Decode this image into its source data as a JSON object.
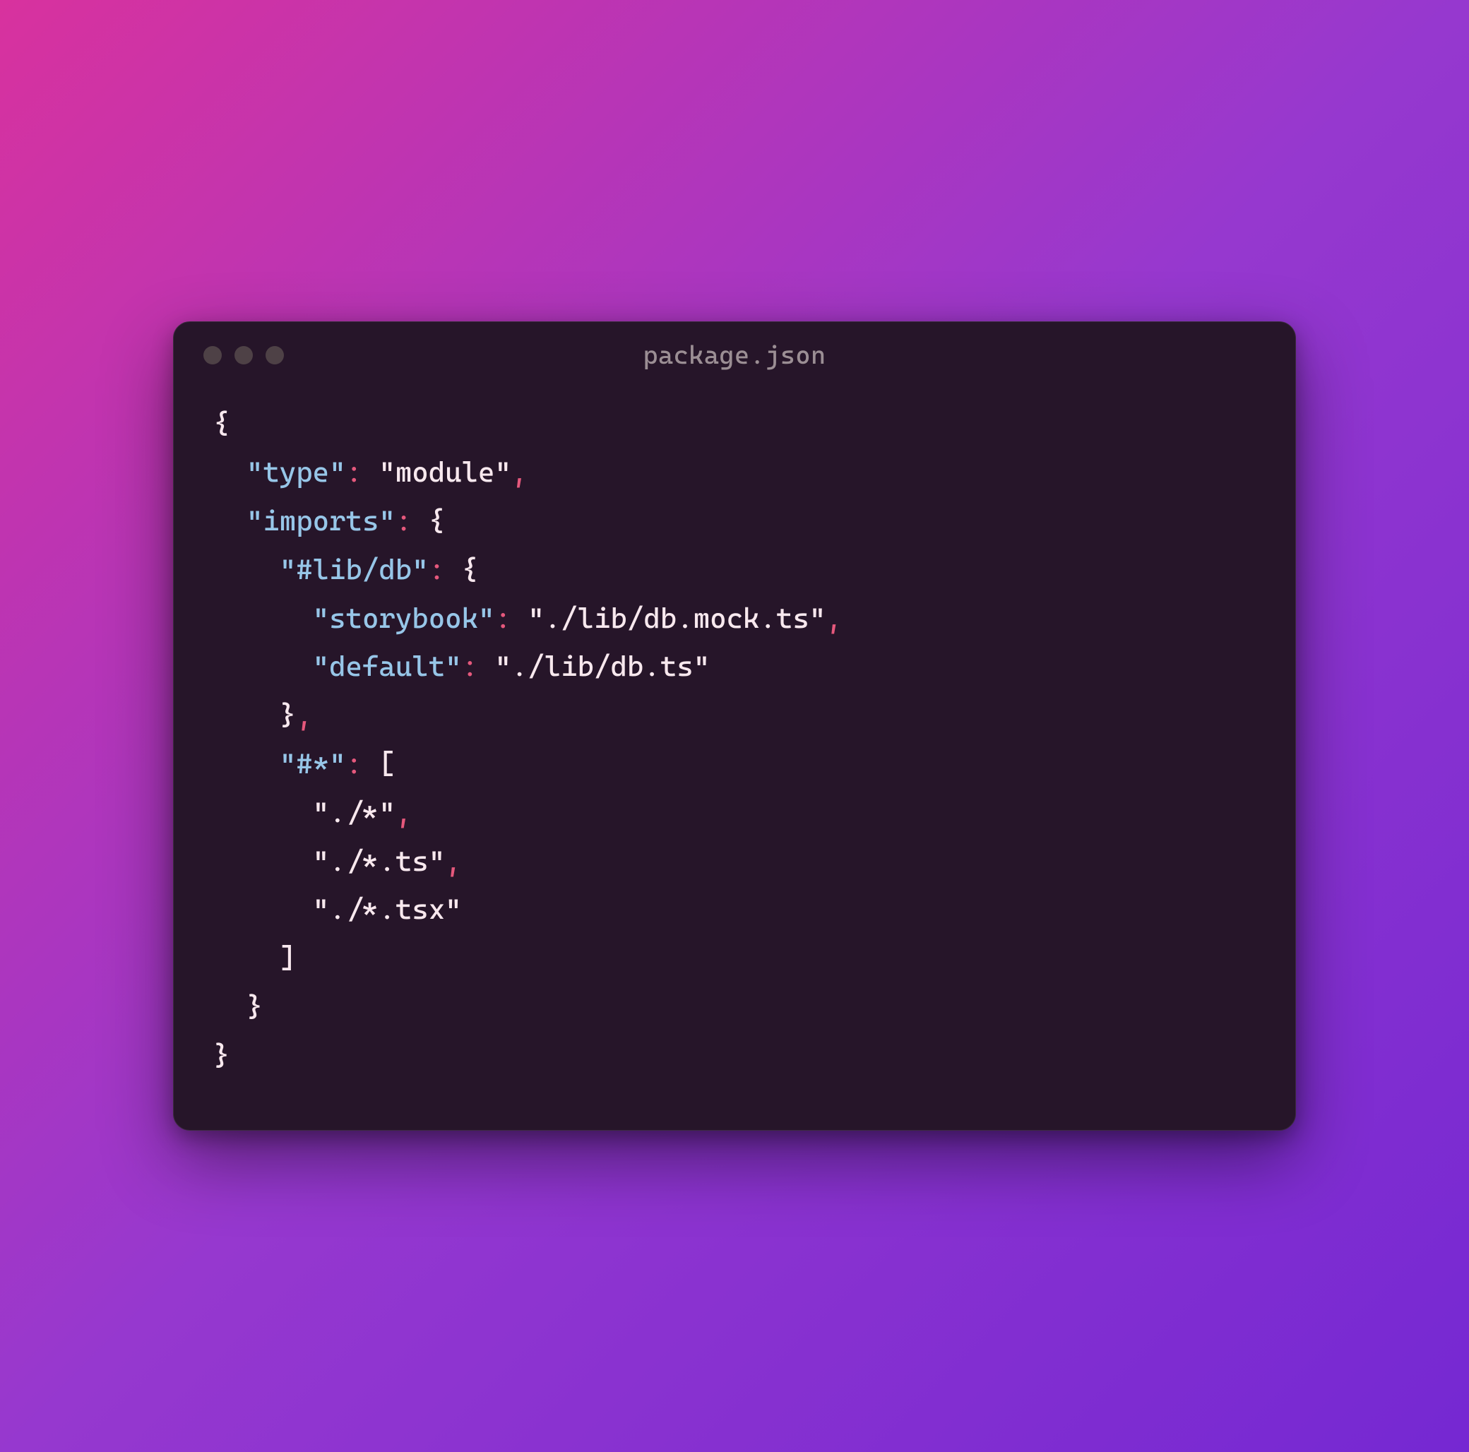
{
  "window": {
    "title": "package.json"
  },
  "code": {
    "tokens": [
      [
        [
          "brace",
          "{"
        ]
      ],
      [
        [
          "plain",
          "  "
        ],
        [
          "key",
          "\"type\""
        ],
        [
          "colon",
          ":"
        ],
        [
          "plain",
          " "
        ],
        [
          "string",
          "\"module\""
        ],
        [
          "comma",
          ","
        ]
      ],
      [
        [
          "plain",
          "  "
        ],
        [
          "key",
          "\"imports\""
        ],
        [
          "colon",
          ":"
        ],
        [
          "plain",
          " "
        ],
        [
          "brace",
          "{"
        ]
      ],
      [
        [
          "plain",
          "    "
        ],
        [
          "key",
          "\"#lib/db\""
        ],
        [
          "colon",
          ":"
        ],
        [
          "plain",
          " "
        ],
        [
          "brace",
          "{"
        ]
      ],
      [
        [
          "plain",
          "      "
        ],
        [
          "key",
          "\"storybook\""
        ],
        [
          "colon",
          ":"
        ],
        [
          "plain",
          " "
        ],
        [
          "string",
          "\"./lib/db.mock.ts\""
        ],
        [
          "comma",
          ","
        ]
      ],
      [
        [
          "plain",
          "      "
        ],
        [
          "key",
          "\"default\""
        ],
        [
          "colon",
          ":"
        ],
        [
          "plain",
          " "
        ],
        [
          "string",
          "\"./lib/db.ts\""
        ]
      ],
      [
        [
          "plain",
          "    "
        ],
        [
          "brace",
          "}"
        ],
        [
          "comma",
          ","
        ]
      ],
      [
        [
          "plain",
          "    "
        ],
        [
          "key",
          "\"#*\""
        ],
        [
          "colon",
          ":"
        ],
        [
          "plain",
          " "
        ],
        [
          "brace",
          "["
        ]
      ],
      [
        [
          "plain",
          "      "
        ],
        [
          "string",
          "\"./*\""
        ],
        [
          "comma",
          ","
        ]
      ],
      [
        [
          "plain",
          "      "
        ],
        [
          "string",
          "\"./*.ts\""
        ],
        [
          "comma",
          ","
        ]
      ],
      [
        [
          "plain",
          "      "
        ],
        [
          "string",
          "\"./*.tsx\""
        ]
      ],
      [
        [
          "plain",
          "    "
        ],
        [
          "brace",
          "]"
        ]
      ],
      [
        [
          "plain",
          "  "
        ],
        [
          "brace",
          "}"
        ]
      ],
      [
        [
          "brace",
          "}"
        ]
      ]
    ]
  }
}
